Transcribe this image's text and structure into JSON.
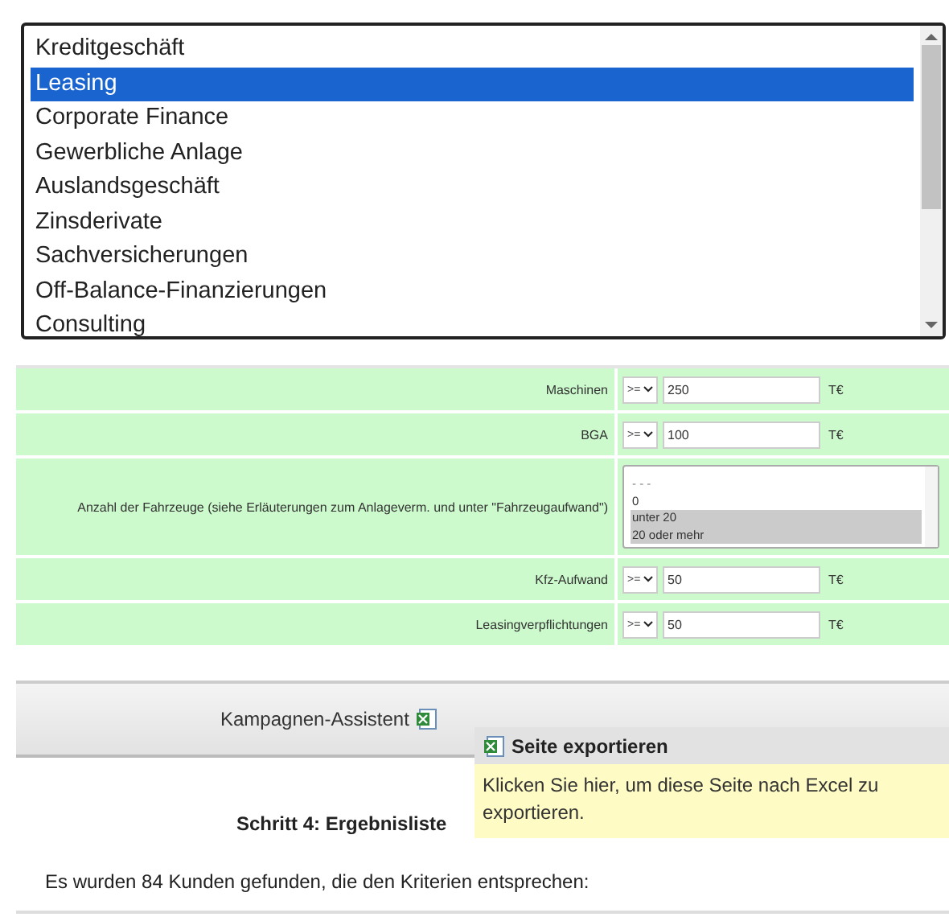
{
  "category_list": {
    "items": [
      {
        "label": "Kreditgeschäft",
        "selected": false
      },
      {
        "label": "Leasing",
        "selected": true
      },
      {
        "label": "Corporate Finance",
        "selected": false
      },
      {
        "label": "Gewerbliche Anlage",
        "selected": false
      },
      {
        "label": "Auslandsgeschäft",
        "selected": false
      },
      {
        "label": "Zinsderivate",
        "selected": false
      },
      {
        "label": "Sachversicherungen",
        "selected": false
      },
      {
        "label": "Off-Balance-Finanzierungen",
        "selected": false
      },
      {
        "label": "Consulting",
        "selected": false
      }
    ]
  },
  "criteria": [
    {
      "kind": "number",
      "label": "Maschinen",
      "operator": ">=",
      "value": "250",
      "unit": "T€"
    },
    {
      "kind": "number",
      "label": "BGA",
      "operator": ">=",
      "value": "100",
      "unit": "T€"
    },
    {
      "kind": "multiselect",
      "label": "Anzahl der Fahrzeuge (siehe Erläuterungen zum Anlageverm. und unter \"Fahrzeugaufwand\")",
      "options": [
        {
          "label": "- - -",
          "selected": false
        },
        {
          "label": "0",
          "selected": false
        },
        {
          "label": "unter 20",
          "selected": true
        },
        {
          "label": "20 oder mehr",
          "selected": true
        }
      ]
    },
    {
      "kind": "number",
      "label": "Kfz-Aufwand",
      "operator": ">=",
      "value": "50",
      "unit": "T€"
    },
    {
      "kind": "number",
      "label": "Leasingverpflichtungen",
      "operator": ">=",
      "value": "50",
      "unit": "T€"
    }
  ],
  "toolbar": {
    "label": "Kampagnen-Assistent"
  },
  "tooltip": {
    "title": "Seite exportieren",
    "text": "Klicken Sie hier, um diese Seite nach Excel zu exportieren."
  },
  "step_title": "Schritt 4: Ergebnisliste",
  "result_text": "Es wurden 84 Kunden gefunden, die den Kriterien entsprechen:"
}
